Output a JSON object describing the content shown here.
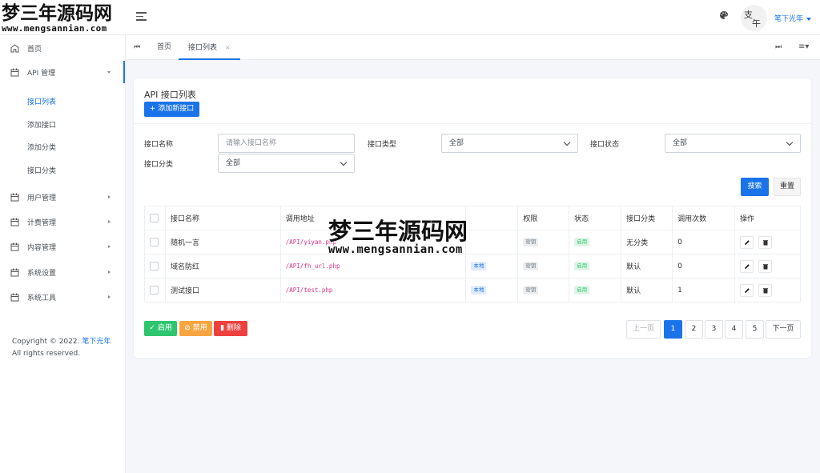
{
  "logo": {
    "cn": "梦三年源码网",
    "url": "www.mengsannian.com"
  },
  "header": {
    "username": "笔下光年"
  },
  "sidebar": {
    "items": [
      {
        "label": "首页",
        "icon": "home-icon"
      },
      {
        "label": "API 管理",
        "icon": "calendar-icon",
        "expanded": true
      },
      {
        "label": "用户管理",
        "icon": "calendar-icon"
      },
      {
        "label": "计费管理",
        "icon": "calendar-icon"
      },
      {
        "label": "内容管理",
        "icon": "calendar-icon"
      },
      {
        "label": "系统设置",
        "icon": "calendar-icon"
      },
      {
        "label": "系统工具",
        "icon": "calendar-icon"
      }
    ],
    "subitems": [
      "接口列表",
      "添加接口",
      "添加分类",
      "接口分类"
    ],
    "active_subitem": "接口列表",
    "copyright_prefix": "Copyright © 2022.",
    "copyright_link": "笔下光年",
    "copyright_suffix": "All rights reserved."
  },
  "tabs": {
    "first_icon": "⏮",
    "items": [
      {
        "label": "首页",
        "active": false
      },
      {
        "label": "接口列表",
        "active": true,
        "close": "×"
      }
    ],
    "last_icon": "⏭",
    "menu_icon": "≡▾"
  },
  "card": {
    "title": "API 接口列表",
    "add_button": "+ 添加新接口"
  },
  "filters": {
    "name_label": "接口名称",
    "name_placeholder": "请输入接口名称",
    "type_label": "接口类型",
    "type_value": "全部",
    "status_label": "接口状态",
    "status_value": "全部",
    "category_label": "接口分类",
    "category_value": "全部",
    "search_button": "搜索",
    "reset_button": "重置"
  },
  "table": {
    "headers": [
      "接口名称",
      "调用地址",
      "",
      "权限",
      "状态",
      "接口分类",
      "调用次数",
      "操作"
    ],
    "rows": [
      {
        "name": "随机一言",
        "url": "/API/yiyan.php",
        "type": "",
        "perm": "密钥",
        "status": "启用",
        "category": "无分类",
        "count": "0"
      },
      {
        "name": "域名防红",
        "url": "/API/fh_url.php",
        "type": "本地",
        "perm": "密钥",
        "status": "启用",
        "category": "默认",
        "count": "0"
      },
      {
        "name": "测试接口",
        "url": "/API/test.php",
        "type": "本地",
        "perm": "密钥",
        "status": "启用",
        "category": "默认",
        "count": "1"
      }
    ]
  },
  "bulk": {
    "enable": "✓ 启用",
    "disable": "⊘ 禁用",
    "delete": "删除"
  },
  "pagination": {
    "prev": "上一页",
    "pages": [
      "1",
      "2",
      "3",
      "4",
      "5"
    ],
    "current": "1",
    "next": "下一页"
  },
  "watermark": {
    "cn": "梦三年源码网",
    "url": "www.mengsannian.com"
  },
  "colors": {
    "primary": "#1a73e8",
    "success": "#2ec56f",
    "warning": "#f7a541",
    "danger": "#ef4040"
  }
}
